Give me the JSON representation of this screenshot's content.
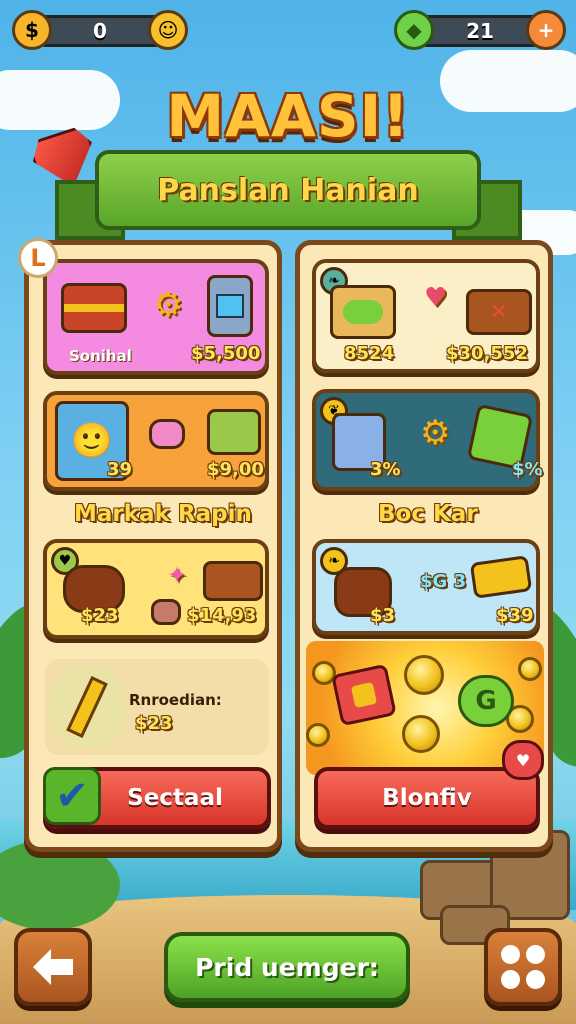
{
  "hud": {
    "left_value": "0",
    "right_value": "21",
    "left_icon": "gold-bag-icon",
    "left_add_icon": "smiley-coin-icon",
    "right_icon": "green-gem-icon",
    "right_add_icon": "plus-icon"
  },
  "title": "MAASI!",
  "subtitle": "Panslan Hanian",
  "level_badge": "L",
  "left_panel": {
    "cards": [
      {
        "label": "Sonihal",
        "price": "$5,500",
        "color": "#f58be0"
      },
      {
        "label": "39",
        "price": "$9,00",
        "color": "#f7a23a"
      }
    ],
    "section_title": "Markak Rapin",
    "card3": {
      "price_a": "$23",
      "price_b": "$14,93",
      "color": "#ffe27a"
    },
    "info": {
      "label": "Rnroedian:",
      "value": "$23"
    },
    "button_label": "Sectaal"
  },
  "right_panel": {
    "cards": [
      {
        "price_a": "8524",
        "price_b": "$30,552",
        "color": "#fbefc8"
      },
      {
        "price_a": "3%",
        "price_b": "$%",
        "color": "#2f6b7a"
      }
    ],
    "section_title": "Boc Kar",
    "card3": {
      "price_a": "$3",
      "price_b": "$G 3",
      "price_c": "$39",
      "color": "#bfe6f6"
    },
    "button_label": "Blonfiv"
  },
  "bottom": {
    "center_label": "Prid uemger:",
    "left_icon": "arrow-left-icon",
    "right_icon": "dice-icon"
  },
  "colors": {
    "sky": "#4fb3e8",
    "panel": "#fbe8b6",
    "button_red": "#e84a3a",
    "button_green": "#5ab52a",
    "title_gold": "#ffc23a"
  }
}
